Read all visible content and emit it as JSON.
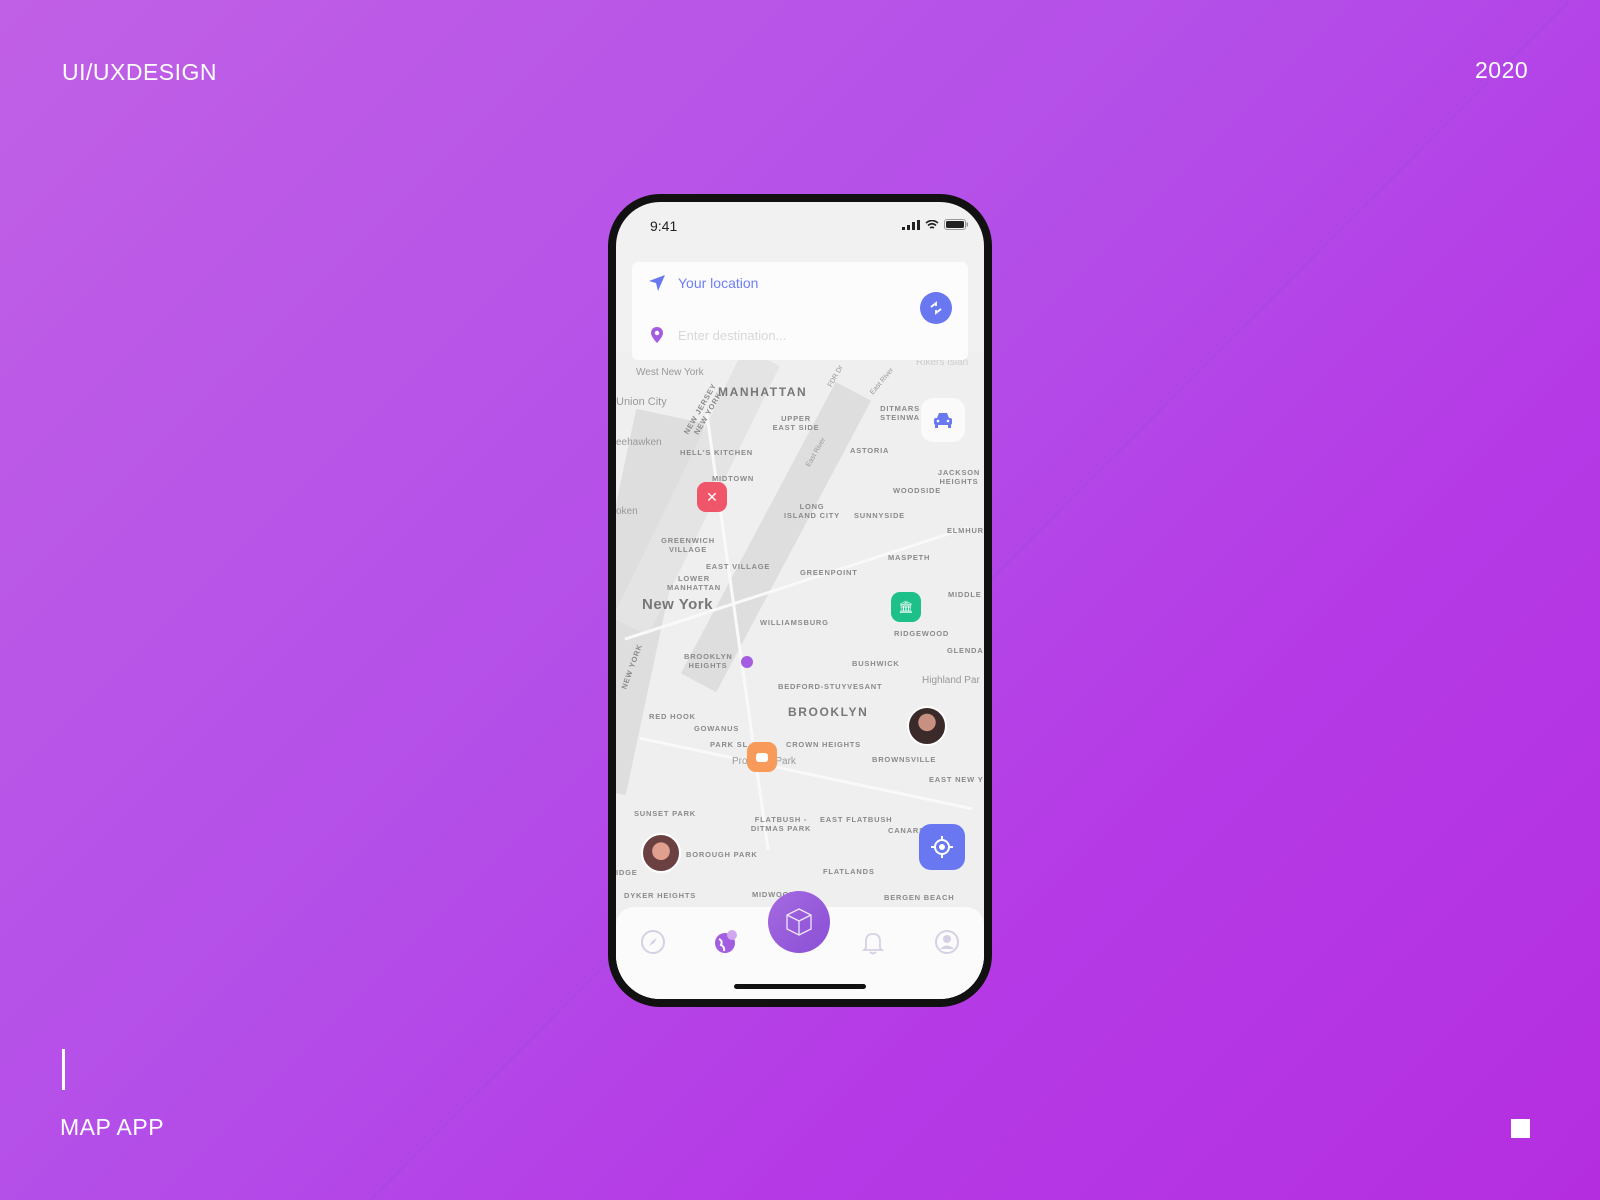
{
  "header": {
    "left": "UI/UXDESIGN",
    "right": "2020"
  },
  "footer": {
    "title": "MAP APP"
  },
  "phone": {
    "time": "9:41",
    "search": {
      "origin": "Your location",
      "destination_placeholder": "Enter destination..."
    },
    "map_labels": {
      "west_new_york": "West New York",
      "union_city": "Union City",
      "weehawken": "eehawken",
      "hoboken": "oken",
      "manhattan": "MANHATTAN",
      "nj_ny": "NEW JERSEY NEW YORK",
      "upper_east_side": "UPPER EAST SIDE",
      "hells_kitchen": "HELL'S KITCHEN",
      "midtown": "MIDTOWN",
      "greenwich": "GREENWICH VILLAGE",
      "east_village": "EAST VILLAGE",
      "lower_manhattan": "LOWER MANHATTAN",
      "new_york": "New York",
      "williamsburg": "WILLIAMSBURG",
      "greenpoint": "GREENPOINT",
      "long_island_city": "LONG ISLAND CITY",
      "sunnyside": "SUNNYSIDE",
      "astoria": "ASTORIA",
      "ditmars": "DITMARS STEINWA",
      "woodside": "WOODSIDE",
      "jackson": "JACKSON HEIGHTS",
      "elmhurst": "ELMHUR",
      "maspeth": "MASPETH",
      "middle": "MIDDLE",
      "ridgewood": "RIDGEWOOD",
      "glendale": "GLENDA",
      "bushwick": "BUSHWICK",
      "brooklyn_heights": "BROOKLYN HEIGHTS",
      "bed_stuy": "BEDFORD-STUYVESANT",
      "highland": "Highland Par",
      "brooklyn": "BROOKLYN",
      "red_hook": "RED HOOK",
      "gowanus": "GOWANUS",
      "park_slope": "PARK SL",
      "crown_heights": "CROWN HEIGHTS",
      "prospect_park": "Pro          Park",
      "brownsville": "BROWNSVILLE",
      "east_new_york": "EAST NEW Y",
      "sunset_park": "SUNSET PARK",
      "flatbush": "FLATBUSH - DITMAS PARK",
      "east_flatbush": "EAST FLATBUSH",
      "canarsie": "CANARS",
      "borough_park": "BOROUGH PARK",
      "ridge": "IDGE",
      "flatlands": "FLATLANDS",
      "dyker": "DYKER HEIGHTS",
      "midwood": "MIDWOOD",
      "bergen": "BERGEN BEACH",
      "rikers": "Rikers Islan",
      "fdr": "FDR Dr",
      "east_river": "East River",
      "east_river2": "East River",
      "ny_vertical": "NEW YORK"
    },
    "pins": {
      "restaurant": "#f0566a",
      "museum": "#1ec08a",
      "chat": "#f79a5a",
      "car": "#6978f0"
    },
    "nav": [
      "compass",
      "explore-globe",
      "ar-cube",
      "notifications",
      "profile"
    ],
    "accent": "#6978f0"
  }
}
